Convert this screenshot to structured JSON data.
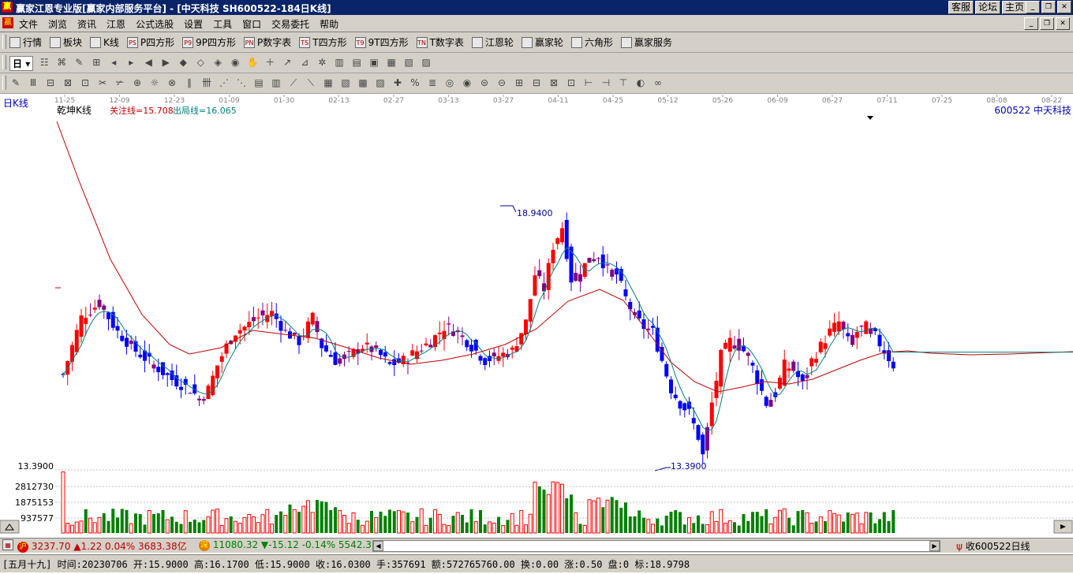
{
  "window": {
    "title": "赢家江恩专业版[赢家内部服务平台] - [中天科技  SH600522-184日K线]",
    "links": [
      "客服",
      "论坛",
      "主页"
    ]
  },
  "menu": [
    "文件",
    "浏览",
    "资讯",
    "江恩",
    "公式选股",
    "设置",
    "工具",
    "窗口",
    "交易委托",
    "帮助"
  ],
  "toolbar1": [
    {
      "label": "行情",
      "icon": "grid-icon"
    },
    {
      "label": "板块",
      "icon": "board-icon"
    },
    {
      "label": "K线",
      "icon": "candle-icon"
    },
    {
      "label": "P四方形",
      "icon": "ps-icon",
      "code": "PS"
    },
    {
      "label": "9P四方形",
      "icon": "p9-icon",
      "code": "P9"
    },
    {
      "label": "P数字表",
      "icon": "pn-icon",
      "code": "PN"
    },
    {
      "label": "T四方形",
      "icon": "ts-icon",
      "code": "TS"
    },
    {
      "label": "9T四方形",
      "icon": "t9-icon",
      "code": "T9"
    },
    {
      "label": "T数字表",
      "icon": "tn-icon",
      "code": "TN"
    },
    {
      "label": "江恩轮",
      "icon": "gann-wheel-icon"
    },
    {
      "label": "赢家轮",
      "icon": "winner-wheel-icon"
    },
    {
      "label": "六角形",
      "icon": "hexagon-icon"
    },
    {
      "label": "赢家服务",
      "icon": "service-icon"
    }
  ],
  "toolbar2": {
    "period": "日"
  },
  "chart": {
    "panel_label": "日K线",
    "indicator_name": "乾坤K线",
    "attention_line": "关注线=15.708",
    "exit_line": "出局线=16.065",
    "stock_label": "600522  中天科技",
    "high_label": "18.9400",
    "low_label": "13.3900",
    "vol_top_label": "13.3900",
    "vol_labels": [
      "2812730",
      "1875153",
      "937577"
    ],
    "colors": {
      "up": "#ff0000",
      "down": "#0000ff",
      "purple": "#800080",
      "ma_fast": "#008080",
      "ma_slow": "#c00000",
      "volume_down": "#008000"
    }
  },
  "chart_data": {
    "type": "candlestick",
    "x_ticks": [
      "11-25",
      "12-09",
      "12-23",
      "01-09",
      "01-30",
      "02-13",
      "02-27",
      "03-13",
      "03-27",
      "04-11",
      "04-25",
      "05-12",
      "05-26",
      "06-09",
      "06-27",
      "07-11",
      "07-25",
      "08-08",
      "08-22"
    ],
    "price_high": 18.94,
    "price_low": 13.39
  },
  "status": {
    "sh_index": "3237.70",
    "sh_change": "▲1.22 0.04% 3683.38亿",
    "sz_index": "11080.32",
    "sz_change": "▼-15.12 -0.14% 5542.3",
    "right_text": "收600522日线",
    "detail": "[五月十九] 时间:20230706 开:15.9000 高:16.1700 低:15.9000 收:16.0300 手:357691 额:572765760.00 换:0.00 涨:0.50 盘:0 标:18.9798"
  }
}
